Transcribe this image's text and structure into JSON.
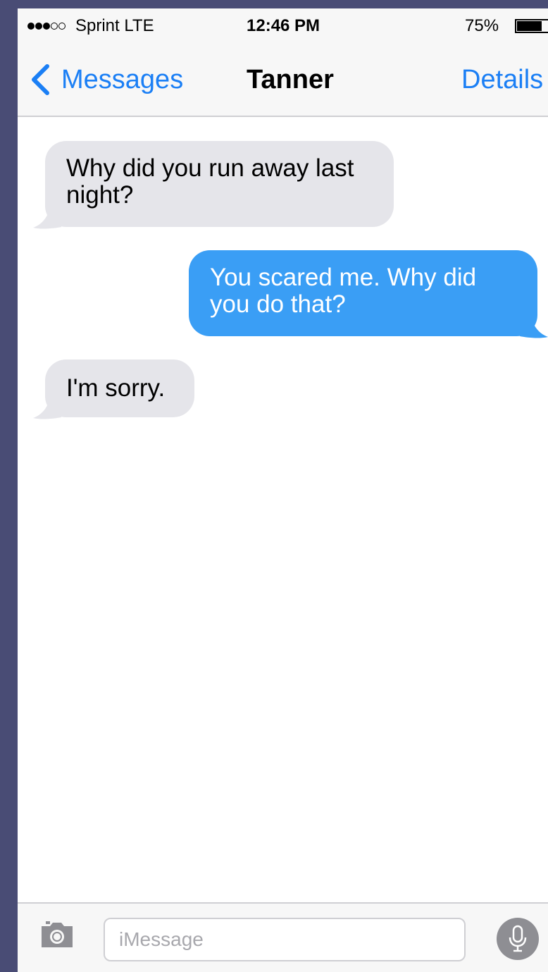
{
  "status_bar": {
    "signal_icon": "signal-dots-icon",
    "signal_bars_filled": 3,
    "signal_bars_total": 5,
    "carrier": "Sprint  LTE",
    "time": "12:46 PM",
    "battery_percent": "75%",
    "battery_icon": "battery-icon",
    "battery_level": 0.75
  },
  "nav": {
    "back_icon": "chevron-left-icon",
    "back_label": "Messages",
    "title": "Tanner",
    "details_label": "Details"
  },
  "messages": [
    {
      "direction": "incoming",
      "text": "Why did you run away last night?"
    },
    {
      "direction": "outgoing",
      "text": "You scared me. Why did you do that?"
    },
    {
      "direction": "incoming",
      "text": "I'm sorry."
    }
  ],
  "input_bar": {
    "camera_icon": "camera-icon",
    "placeholder": "iMessage",
    "value": "",
    "mic_icon": "microphone-icon"
  },
  "colors": {
    "accent": "#1b7ff5",
    "outgoing_bubble": "#3a9ef5",
    "incoming_bubble": "#e5e5ea",
    "background_frame": "#494c75"
  }
}
